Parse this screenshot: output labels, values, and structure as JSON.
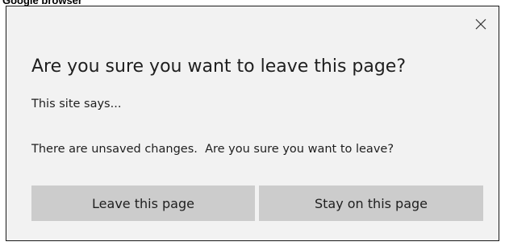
{
  "caption": "Google browser",
  "dialog": {
    "title": "Are you sure you want to leave this page?",
    "site_says": "This site says...",
    "message": "There are unsaved changes.  Are you sure you want to leave?",
    "close_icon": "close-icon",
    "buttons": {
      "leave_label": "Leave this page",
      "stay_label": "Stay on this page"
    }
  },
  "colors": {
    "dialog_background": "#f2f2f2",
    "button_background": "#cccccc",
    "text": "#1f1f1f",
    "border": "#1a1a1a"
  }
}
